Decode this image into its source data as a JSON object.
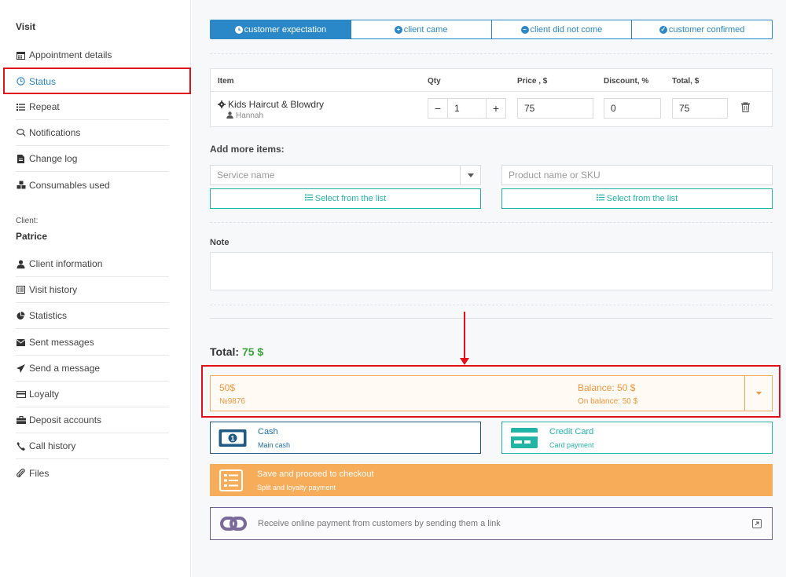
{
  "sidebar": {
    "visit_heading": "Visit",
    "visit_items": [
      {
        "label": "Appointment details",
        "icon": "calendar-icon"
      },
      {
        "label": "Status",
        "icon": "clock-icon"
      },
      {
        "label": "Repeat",
        "icon": "list-icon"
      },
      {
        "label": "Notifications",
        "icon": "comments-icon"
      },
      {
        "label": "Change log",
        "icon": "file-icon"
      },
      {
        "label": "Consumables used",
        "icon": "cubes-icon"
      }
    ],
    "client_sublabel": "Client:",
    "client_name": "Patrice",
    "client_items": [
      {
        "label": "Client information",
        "icon": "user-icon"
      },
      {
        "label": "Visit history",
        "icon": "list-alt-icon"
      },
      {
        "label": "Statistics",
        "icon": "pie-chart-icon"
      },
      {
        "label": "Sent messages",
        "icon": "envelope-icon"
      },
      {
        "label": "Send a message",
        "icon": "paper-plane-icon"
      },
      {
        "label": "Loyalty",
        "icon": "credit-card-icon"
      },
      {
        "label": "Deposit accounts",
        "icon": "briefcase-icon"
      },
      {
        "label": "Call history",
        "icon": "phone-icon"
      },
      {
        "label": "Files",
        "icon": "paperclip-icon"
      }
    ]
  },
  "status_tabs": [
    {
      "label": "customer expectation",
      "icon": "clock-icon",
      "active": true
    },
    {
      "label": "client came",
      "icon": "plus-circle-icon",
      "active": false
    },
    {
      "label": "client did not come",
      "icon": "minus-circle-icon",
      "active": false
    },
    {
      "label": "customer confirmed",
      "icon": "check-circle-icon",
      "active": false
    }
  ],
  "items_table": {
    "headers": {
      "item": "Item",
      "qty": "Qty",
      "price": "Price , $",
      "discount": "Discount, %",
      "total": "Total, $"
    },
    "rows": [
      {
        "name": "Kids Haircut & Blowdry",
        "staff": "Hannah",
        "qty": "1",
        "price": "75",
        "discount": "0",
        "total": "75"
      }
    ]
  },
  "add_items": {
    "label": "Add more items:",
    "service_placeholder": "Service name",
    "product_placeholder": "Product name or SKU",
    "select_list_label": "Select from the list"
  },
  "note": {
    "label": "Note",
    "value": ""
  },
  "total": {
    "label": "Total:",
    "amount": "75 $"
  },
  "account": {
    "amount": "50$",
    "number": "№9876",
    "balance": "Balance: 50 $",
    "on_balance": "On balance: 50 $"
  },
  "payments": {
    "cash": {
      "title": "Cash",
      "subtitle": "Main cash"
    },
    "credit_card": {
      "title": "Credit Card",
      "subtitle": "Card payment"
    },
    "checkout": {
      "title": "Save and proceed to checkout",
      "subtitle": "Split and loyalty payment"
    },
    "online": {
      "title": "Receive online payment from customers by sending them a link"
    }
  },
  "colors": {
    "primary": "#2a87c8",
    "teal": "#22b5a6",
    "orange": "#f6ac58",
    "annotation_red": "#e2101a",
    "total_green": "#3aa33a"
  }
}
